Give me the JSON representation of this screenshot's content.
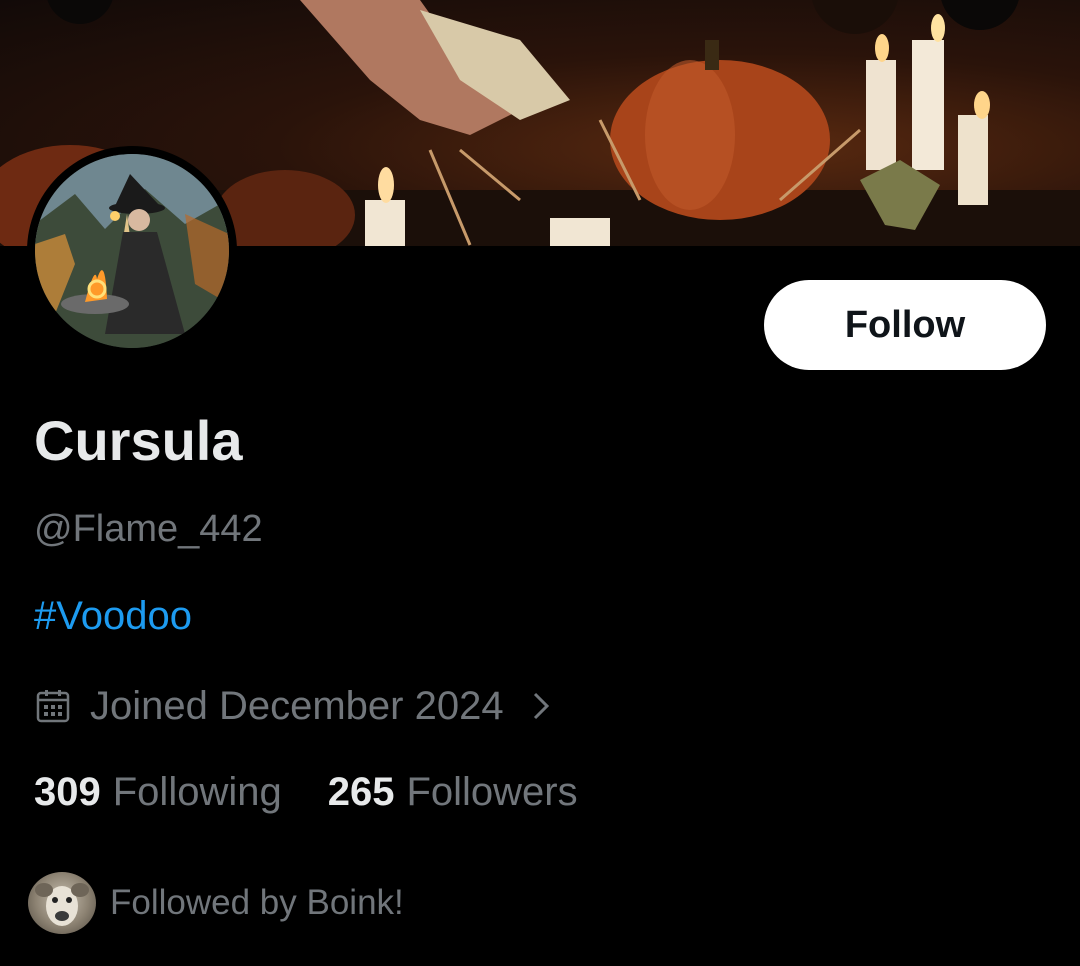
{
  "profile": {
    "display_name": "Cursula",
    "handle": "@Flame_442",
    "bio_hashtag": "#Voodoo",
    "joined": "Joined December 2024",
    "following_count": "309",
    "following_label": "Following",
    "followers_count": "265",
    "followers_label": "Followers",
    "followed_by": "Followed by Boink!"
  },
  "actions": {
    "follow_label": "Follow"
  },
  "icons": {
    "calendar": "calendar-icon",
    "chevron": "chevron-right-icon"
  },
  "colors": {
    "background": "#000000",
    "primary_text": "#e7e9ea",
    "secondary_text": "#71767b",
    "link": "#1d9bf0",
    "button_bg": "#ffffff"
  }
}
